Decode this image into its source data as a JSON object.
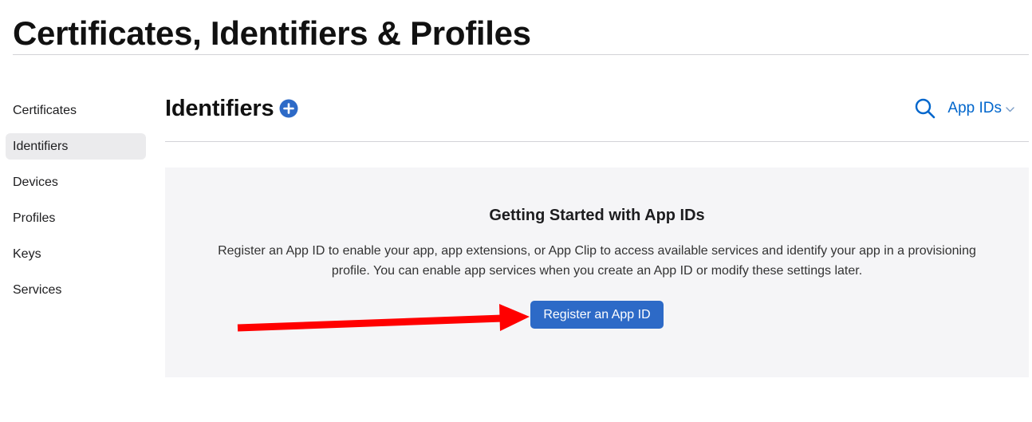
{
  "page": {
    "title": "Certificates, Identifiers & Profiles"
  },
  "sidebar": {
    "items": [
      {
        "label": "Certificates",
        "active": false
      },
      {
        "label": "Identifiers",
        "active": true
      },
      {
        "label": "Devices",
        "active": false
      },
      {
        "label": "Profiles",
        "active": false
      },
      {
        "label": "Keys",
        "active": false
      },
      {
        "label": "Services",
        "active": false
      }
    ]
  },
  "section": {
    "title": "Identifiers",
    "add_icon": "plus-circle-icon",
    "search_icon": "search-icon",
    "filter_label": "App IDs",
    "filter_icon": "chevron-down-icon"
  },
  "getting_started": {
    "heading": "Getting Started with App IDs",
    "description": "Register an App ID to enable your app, app extensions, or App Clip to access available services and identify your app in a provisioning profile. You can enable app services when you create an App ID or modify these settings later.",
    "button_label": "Register an App ID"
  },
  "annotation": {
    "type": "arrow",
    "color": "#ff0000"
  },
  "colors": {
    "accent": "#0066cc",
    "button": "#2d6ac7",
    "panel_bg": "#f5f5f7",
    "active_item_bg": "#ebebed"
  }
}
